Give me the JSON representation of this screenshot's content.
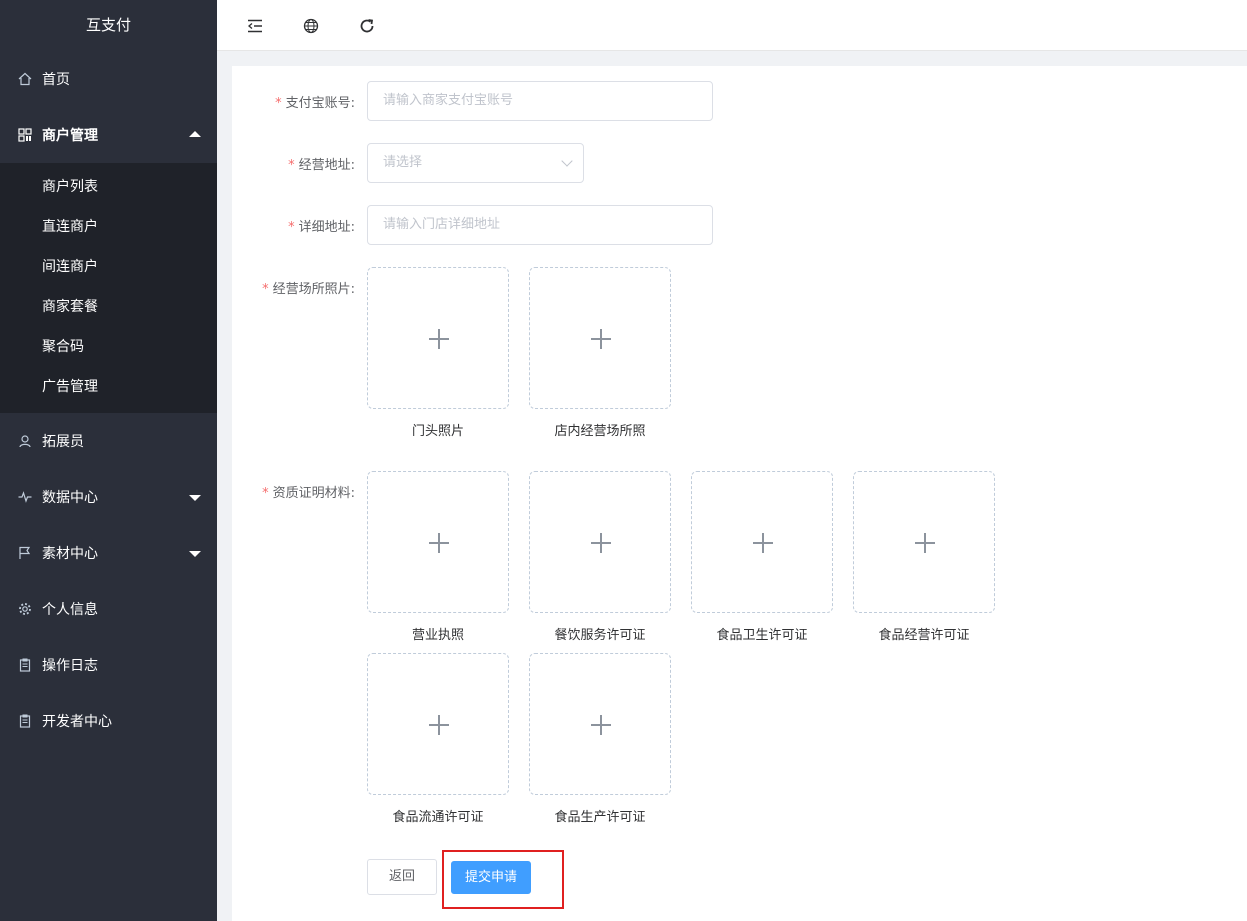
{
  "app": {
    "title": "互支付"
  },
  "sidebar": {
    "items": [
      {
        "label": "首页",
        "icon": "home-icon"
      },
      {
        "label": "商户管理",
        "icon": "grid-icon",
        "expanded": true,
        "children": [
          {
            "label": "商户列表"
          },
          {
            "label": "直连商户"
          },
          {
            "label": "间连商户"
          },
          {
            "label": "商家套餐"
          },
          {
            "label": "聚合码"
          },
          {
            "label": "广告管理"
          }
        ]
      },
      {
        "label": "拓展员",
        "icon": "user-icon"
      },
      {
        "label": "数据中心",
        "icon": "pulse-icon"
      },
      {
        "label": "素材中心",
        "icon": "flag-icon"
      },
      {
        "label": "个人信息",
        "icon": "gear-icon"
      },
      {
        "label": "操作日志",
        "icon": "clipboard-icon"
      },
      {
        "label": "开发者中心",
        "icon": "clipboard-icon"
      }
    ]
  },
  "topbar": {
    "icons": [
      "menu-fold-icon",
      "globe-icon",
      "refresh-icon"
    ]
  },
  "form": {
    "alipay_account": {
      "label": "支付宝账号:",
      "placeholder": "请输入商家支付宝账号"
    },
    "business_address": {
      "label": "经营地址:",
      "placeholder": "请选择"
    },
    "detail_address": {
      "label": "详细地址:",
      "placeholder": "请输入门店详细地址"
    },
    "venue_photos": {
      "label": "经营场所照片:",
      "uploads": [
        "门头照片",
        "店内经营场所照"
      ]
    },
    "qualifications": {
      "label": "资质证明材料:",
      "uploads": [
        "营业执照",
        "餐饮服务许可证",
        "食品卫生许可证",
        "食品经营许可证",
        "食品流通许可证",
        "食品生产许可证"
      ]
    },
    "buttons": {
      "back": "返回",
      "submit": "提交申请"
    }
  },
  "colors": {
    "sidebar_bg": "#2b2f3a",
    "submenu_bg": "#1f2229",
    "primary": "#409eff",
    "required": "#f56c6c",
    "highlight": "#e02020"
  }
}
